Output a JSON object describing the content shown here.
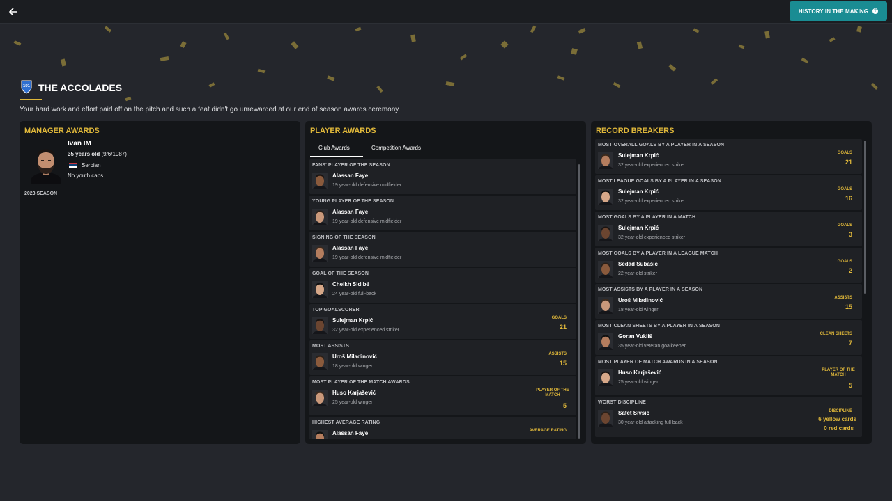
{
  "topbar": {
    "back_icon": "back-arrow-icon",
    "history_button": "HISTORY IN THE MAKING",
    "history_icon": "help-icon"
  },
  "header": {
    "title": "THE ACCOLADES",
    "subtitle": "Your hard work and effort paid off on the pitch and such a feat didn't go unrewarded at our end of season awards ceremony.",
    "icon": "trophy-shield-icon",
    "icon_text": "101"
  },
  "colors": {
    "accent_gold": "#e0b83a",
    "button_teal": "#1a8c93",
    "panel_bg": "#141619",
    "card_bg": "#1f2125"
  },
  "manager": {
    "title": "MANAGER AWARDS",
    "name": "Ivan IM",
    "age_bold": "35 years old",
    "age_rest": " (9/6/1987)",
    "nationality": "Serbian",
    "youth": "No youth caps",
    "season": "2023 SEASON"
  },
  "player_awards": {
    "title": "PLAYER AWARDS",
    "tabs": [
      "Club Awards",
      "Competition Awards"
    ],
    "cards": [
      {
        "title": "FANS' PLAYER OF THE SEASON",
        "name": "Alassan Faye",
        "desc": "19 year-old defensive midfielder"
      },
      {
        "title": "YOUNG PLAYER OF THE SEASON",
        "name": "Alassan Faye",
        "desc": "19 year-old defensive midfielder"
      },
      {
        "title": "SIGNING OF THE SEASON",
        "name": "Alassan Faye",
        "desc": "19 year-old defensive midfielder"
      },
      {
        "title": "GOAL OF THE SEASON",
        "name": "Cheikh Sidibé",
        "desc": "24 year-old full-back"
      },
      {
        "title": "TOP GOALSCORER",
        "name": "Sulejman Krpić",
        "desc": "32 year-old experienced striker",
        "stat_label": "GOALS",
        "stat_value": "21"
      },
      {
        "title": "MOST ASSISTS",
        "name": "Uroš Miladinović",
        "desc": "18 year-old winger",
        "stat_label": "ASSISTS",
        "stat_value": "15"
      },
      {
        "title": "MOST PLAYER OF THE MATCH AWARDS",
        "name": "Huso Karjašević",
        "desc": "25 year-old winger",
        "stat_label": "PLAYER OF THE MATCH",
        "stat_value": "5"
      },
      {
        "title": "HIGHEST AVERAGE RATING",
        "name": "Alassan Faye",
        "desc": "",
        "stat_label": "AVERAGE RATING",
        "stat_value": ""
      }
    ]
  },
  "record_breakers": {
    "title": "RECORD BREAKERS",
    "cards": [
      {
        "title": "MOST OVERALL GOALS BY A PLAYER IN A SEASON",
        "name": "Sulejman Krpić",
        "desc": "32 year-old experienced striker",
        "stat_label": "GOALS",
        "stat_value": "21"
      },
      {
        "title": "MOST LEAGUE GOALS BY A PLAYER IN A SEASON",
        "name": "Sulejman Krpić",
        "desc": "32 year-old experienced striker",
        "stat_label": "GOALS",
        "stat_value": "16"
      },
      {
        "title": "MOST GOALS BY A PLAYER IN A MATCH",
        "name": "Sulejman Krpić",
        "desc": "32 year-old experienced striker",
        "stat_label": "GOALS",
        "stat_value": "3"
      },
      {
        "title": "MOST GOALS BY A PLAYER IN A LEAGUE MATCH",
        "name": "Sedad Subašić",
        "desc": "22 year-old striker",
        "stat_label": "GOALS",
        "stat_value": "2"
      },
      {
        "title": "MOST ASSISTS BY A PLAYER IN A SEASON",
        "name": "Uroš Miladinović",
        "desc": "18 year-old winger",
        "stat_label": "ASSISTS",
        "stat_value": "15"
      },
      {
        "title": "MOST CLEAN SHEETS BY A PLAYER IN A SEASON",
        "name": "Goran Vukliš",
        "desc": "35 year-old veteran goalkeeper",
        "stat_label": "CLEAN SHEETS",
        "stat_value": "7"
      },
      {
        "title": "MOST PLAYER OF MATCH AWARDS IN A SEASON",
        "name": "Huso Karjašević",
        "desc": "25 year-old winger",
        "stat_label": "PLAYER OF THE MATCH",
        "stat_value": "5"
      },
      {
        "title": "WORST DISCIPLINE",
        "name": "Safet Sivsic",
        "desc": "30 year-old attacking full back",
        "stat_label": "DISCIPLINE",
        "stat_value": "6 yellow cards",
        "stat_value2": "0 red cards"
      }
    ]
  }
}
